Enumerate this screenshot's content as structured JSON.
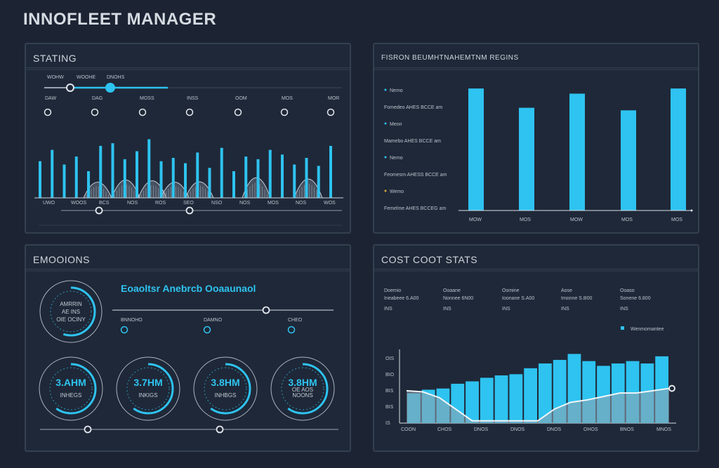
{
  "app": {
    "title": "INNOFLEET MANAGER"
  },
  "panels": {
    "status": {
      "title": "STATING",
      "slider_labels": [
        "WOHW",
        "WOOHE",
        "DNOHS"
      ],
      "channel_labels": [
        "DAW",
        "DAG",
        "MOSS",
        "INSS",
        "OOM",
        "MOS",
        "MOR"
      ],
      "x_labels": [
        "UWO",
        "WOOS",
        "BCS",
        "NOS",
        "ROS",
        "SEO",
        "NSO",
        "NOS",
        "MOS",
        "NOS",
        "WOS"
      ],
      "bar_values": [
        0.55,
        0.72,
        0.5,
        0.62,
        0.4,
        0.78,
        0.82,
        0.58,
        0.7,
        0.88,
        0.55,
        0.6,
        0.52,
        0.68,
        0.45,
        0.75,
        0.4,
        0.62,
        0.58,
        0.72,
        0.65,
        0.5,
        0.6,
        0.48,
        0.78
      ],
      "wave_peaks": [
        0.35,
        0.4,
        0.38,
        0.35,
        0.36,
        0.45,
        0.42
      ]
    },
    "fleet": {
      "title": "FISRON BEUMHTNAHEMTNM REGINS",
      "legend": [
        {
          "label": "Nemo",
          "value": "Fomedeo AHES BCCE am",
          "color": "#2ec3f0"
        },
        {
          "label": "Meon",
          "value": "Mamebo AHES BCCE am",
          "color": "#2ec3f0"
        },
        {
          "label": "Nemo",
          "value": "Feomesm AHESS BCCE am",
          "color": "#2ec3f0"
        },
        {
          "label": "Wemo",
          "value": "Femelme AHES BCCEG am",
          "color": "#d6a83a"
        }
      ],
      "chart_data": {
        "type": "bar",
        "categories": [
          "MOW",
          "MOS",
          "MOW",
          "MOS",
          "MOS"
        ],
        "values": [
          0.95,
          0.8,
          0.91,
          0.78,
          0.95
        ],
        "title": "",
        "xlabel": "",
        "ylabel": ""
      }
    },
    "emissions": {
      "title": "EMOOIONS",
      "subtitle": "Eoaoltsr Anebrcb Ooaaunaol",
      "main_gauge": {
        "line1": "AMRRIN",
        "line2": "AE INS",
        "line3": "OIE OCINY"
      },
      "toggle_labels": [
        "BNNOHO",
        "DAMNO",
        "CHEO"
      ],
      "gauges": [
        {
          "value": "3.AHM",
          "label": "INHEGS"
        },
        {
          "value": "3.7HM",
          "label": "INKIGS"
        },
        {
          "value": "3.8HM",
          "label": "INHBGS"
        },
        {
          "value": "3.8HM",
          "label": "NOONS",
          "tag": "OE AOS"
        }
      ]
    },
    "cost": {
      "title": "COST COOT STATS",
      "stats": [
        {
          "name": "Doemio",
          "value": "Ineabeee 6.A00",
          "sub": "INS"
        },
        {
          "name": "Ooaane",
          "value": "Nonnee 6N00",
          "sub": "INS"
        },
        {
          "name": "Oomine",
          "value": "Ioonane S.A00",
          "sub": "INS"
        },
        {
          "name": "Aose",
          "value": "Imonne S.B00",
          "sub": "INS"
        },
        {
          "name": "Ooaso",
          "value": "Sonene 6.800",
          "sub": "INS"
        }
      ],
      "legend_label": "Wenmomantee",
      "y_ticks": [
        "OIS",
        "BIO",
        "BIS",
        "BIS",
        "IS"
      ],
      "x_labels": [
        "COON",
        "CHOS",
        "DNOS",
        "DNOS",
        "DNOS",
        "OHOS",
        "BNOS",
        "MNOS"
      ],
      "chart_data": {
        "type": "bar",
        "categories": [],
        "values": [
          0.25,
          0.28,
          0.29,
          0.33,
          0.35,
          0.38,
          0.4,
          0.41,
          0.46,
          0.5,
          0.53,
          0.58,
          0.52,
          0.48,
          0.5,
          0.52,
          0.5,
          0.56
        ],
        "line_values": [
          0.28,
          0.27,
          0.22,
          0.12,
          0.02,
          0.02,
          0.02,
          0.02,
          0.02,
          0.12,
          0.18,
          0.2,
          0.23,
          0.26,
          0.26,
          0.28,
          0.3
        ],
        "title": "",
        "xlabel": "",
        "ylabel": ""
      }
    }
  },
  "colors": {
    "accent": "#2ec3f0",
    "panel_bg": "#1f2838",
    "border": "#33404f"
  }
}
